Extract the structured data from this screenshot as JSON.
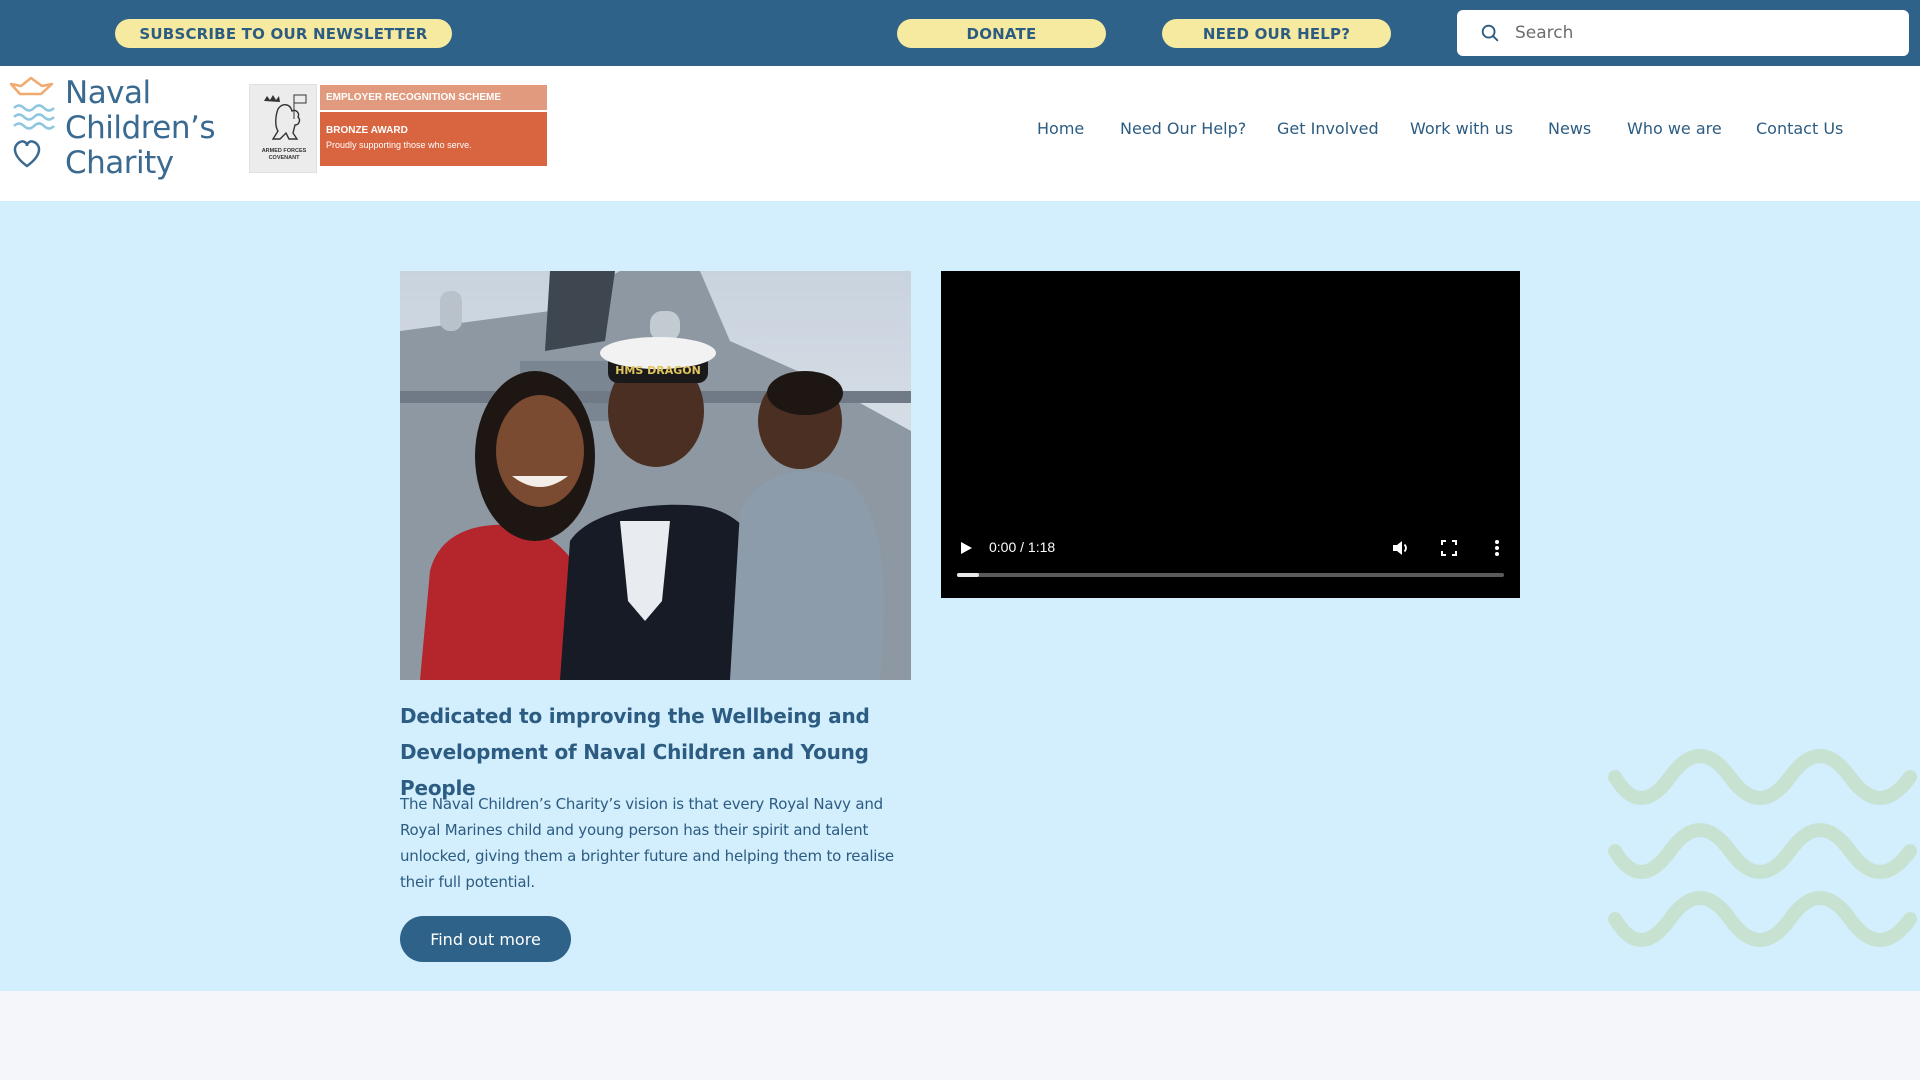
{
  "topbar": {
    "newsletter_label": "SUBSCRIBE TO OUR NEWSLETTER",
    "donate_label": "DONATE",
    "help_label": "NEED OUR HELP?",
    "search": {
      "placeholder": "Search",
      "value": ""
    }
  },
  "logo": {
    "line1": "Naval",
    "line2": "Children’s",
    "line3": "Charity"
  },
  "covenant": {
    "emblem_text": "ARMED FORCES COVENANT",
    "scheme": "EMPLOYER RECOGNITION SCHEME",
    "award": "BRONZE AWARD",
    "tagline": "Proudly supporting those who serve."
  },
  "nav": {
    "items": [
      {
        "label": "Home"
      },
      {
        "label": "Need Our Help?"
      },
      {
        "label": "Get Involved"
      },
      {
        "label": "Work with us"
      },
      {
        "label": "News"
      },
      {
        "label": "Who we are"
      },
      {
        "label": "Contact Us"
      }
    ]
  },
  "hero": {
    "title": "Dedicated to improving the Wellbeing and Development of Naval Children and Young People",
    "body": "The Naval Children’s Charity’s vision is that every Royal Navy and Royal Marines child and young person has their spirit and talent unlocked, giving them a brighter future and helping them to realise their full potential.",
    "cta_label": "Find out more",
    "photo_cap_text": "HMS DRAGON"
  },
  "video": {
    "time": "0:00 / 1:18",
    "progress": 0.04
  },
  "colors": {
    "topbar": "#2e6289",
    "pill": "#f6eaa0",
    "brand_text": "#2c5c82",
    "hero_bg": "#d3eefc",
    "page_bg": "#f4f6fa",
    "award_orange": "#d8653f"
  },
  "icons": {
    "search": "search-icon",
    "play": "play-icon",
    "volume": "volume-icon",
    "fullscreen": "fullscreen-icon",
    "more": "more-vertical-icon"
  }
}
